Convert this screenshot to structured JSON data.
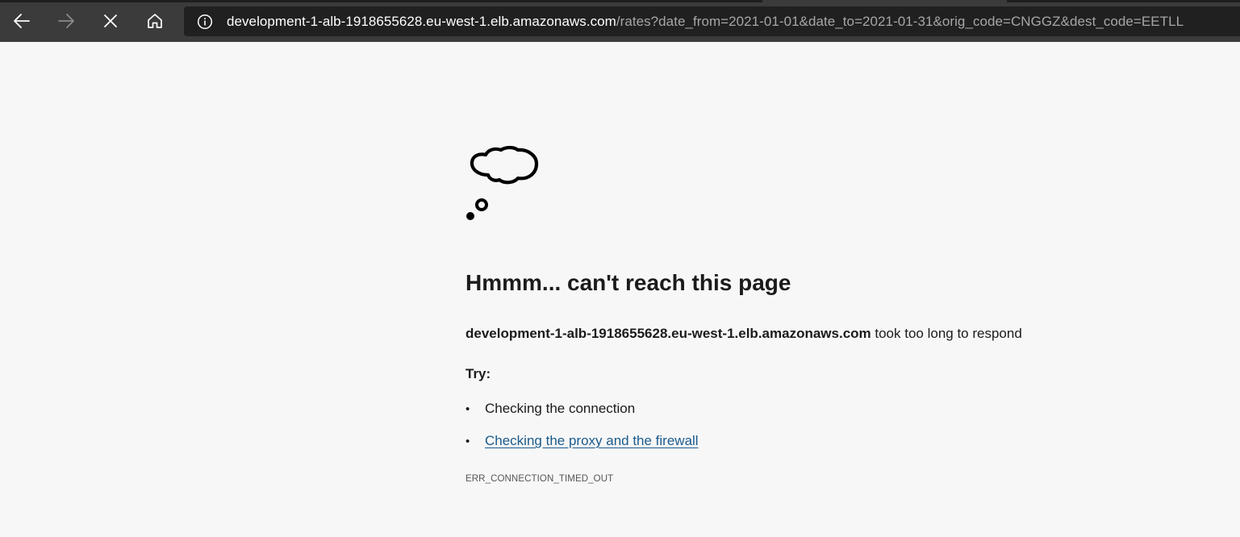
{
  "browser": {
    "back_icon": "arrow-left-icon",
    "forward_icon": "arrow-right-icon",
    "stop_icon": "close-icon",
    "home_icon": "home-icon",
    "site_info_icon": "info-icon",
    "url_host": "development-1-alb-1918655628.eu-west-1.elb.amazonaws.com",
    "url_rest": "/rates?date_from=2021-01-01&date_to=2021-01-31&orig_code=CNGGZ&dest_code=EETLL",
    "toolbar_color": "#3b3b3b",
    "addressbar_color": "#202020"
  },
  "error_page": {
    "illustration_icon": "thought-bubble-icon",
    "title": "Hmmm... can't reach this page",
    "host": "development-1-alb-1918655628.eu-west-1.elb.amazonaws.com",
    "message_suffix": " took too long to respond",
    "try_label": "Try:",
    "suggestions": [
      {
        "bullet": "•",
        "text": "Checking the connection",
        "is_link": false
      },
      {
        "bullet": "•",
        "text": "Checking the proxy and the firewall",
        "is_link": true
      }
    ],
    "error_code": "ERR_CONNECTION_TIMED_OUT",
    "link_color": "#1a5a8c"
  }
}
